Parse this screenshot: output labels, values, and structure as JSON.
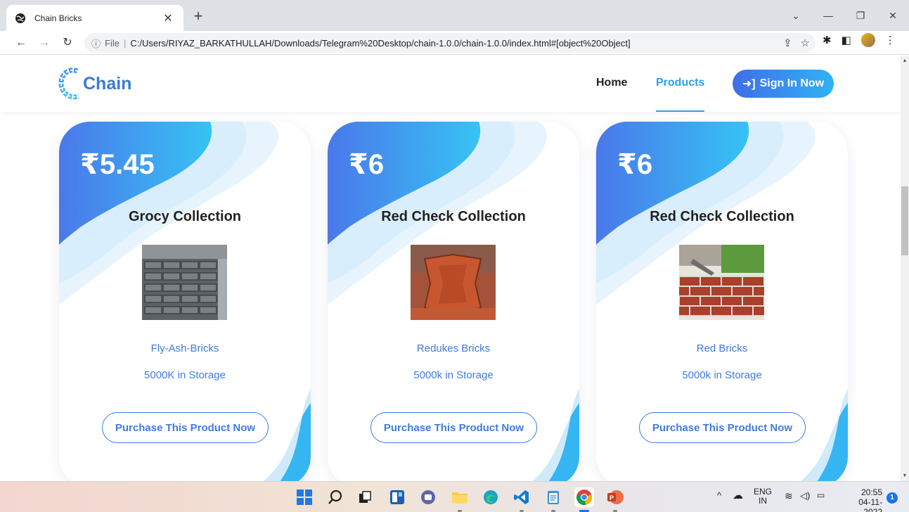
{
  "browser": {
    "tab_title": "Chain Bricks",
    "new_tab": "+",
    "url_prefix": "File",
    "url": "C:/Users/RIYAZ_BARKATHULLAH/Downloads/Telegram%20Desktop/chain-1.0.0/chain-1.0.0/index.html#[object%20Object]"
  },
  "site": {
    "logo_text": "Chain",
    "nav": [
      {
        "label": "Home",
        "active": false
      },
      {
        "label": "Products",
        "active": true
      }
    ],
    "signin_label": "Sign In Now"
  },
  "products": [
    {
      "price": "₹5.45",
      "collection": "Grocy Collection",
      "name": "Fly-Ash-Bricks",
      "storage": "5000K in Storage",
      "button": "Purchase This Product Now"
    },
    {
      "price": "₹6",
      "collection": "Red Check Collection",
      "name": "Redukes Bricks",
      "storage": "5000k in Storage",
      "button": "Purchase This Product Now"
    },
    {
      "price": "₹6",
      "collection": "Red Check Collection",
      "name": "Red Bricks",
      "storage": "5000k in Storage",
      "button": "Purchase This Product Now"
    }
  ],
  "taskbar": {
    "lang": "ENG",
    "region": "IN",
    "time": "20:55",
    "date": "04-11-2022",
    "notifications": "1"
  },
  "colors": {
    "accent": "#2b9ff0",
    "brand_blue": "#3a7bd5",
    "gradient_start": "#3f6ee9",
    "gradient_end": "#30b2f5"
  }
}
